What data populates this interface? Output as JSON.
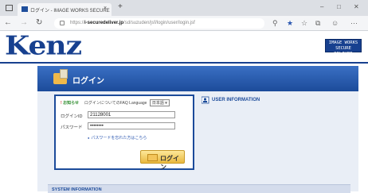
{
  "browser": {
    "tab_title": "ログイン - IMAGE WORKS SECURE",
    "tab_close": "×",
    "new_tab": "+",
    "url_prefix": "https://",
    "url_host": "i-securedeliver.jp",
    "url_path": "/sd/suzuden/jsf/login/user/login.jsf",
    "window_controls": {
      "minimize": "–",
      "maximize": "□",
      "close": "✕"
    }
  },
  "header": {
    "logo": "Kenz",
    "brand_line1": "IMAGE WORKS",
    "brand_line2": "SECURE DELIVER",
    "accent_color": "#17408f"
  },
  "login": {
    "title": "ログイン",
    "notice_label": "お知らせ",
    "notice_text": "ログインについてのFAQ",
    "language_label": "Language",
    "language_value": "日本語",
    "id_label": "ログインID",
    "id_value": "21128001",
    "password_label": "パスワード",
    "password_value": "••••••••",
    "forgot_link": "パスワードを忘れた方はこちら",
    "button_label": "ログイン"
  },
  "user_info": {
    "title": "USER INFORMATION"
  },
  "system_info": {
    "title": "SYSTEM INFORMATION"
  }
}
